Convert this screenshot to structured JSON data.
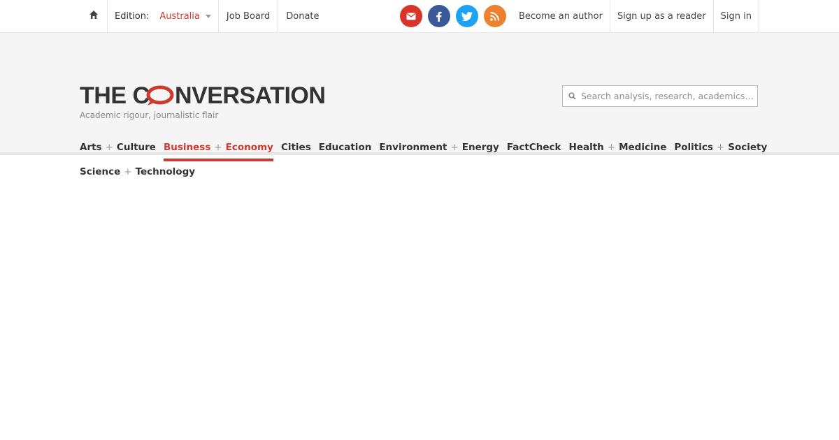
{
  "topbar": {
    "edition_label": "Edition:",
    "edition_value": "Australia",
    "links": [
      "Job Board",
      "Donate"
    ],
    "right_links": [
      "Become an author",
      "Sign up as a reader",
      "Sign in"
    ],
    "social": [
      "email-icon",
      "facebook-icon",
      "twitter-icon",
      "rss-icon"
    ]
  },
  "brand": {
    "name": "THE CONVERSATION",
    "tagline": "Academic rigour, journalistic flair",
    "accent": "#cf3a2f"
  },
  "search": {
    "placeholder": "Search analysis, research, academics…"
  },
  "nav": {
    "items": [
      {
        "a": "Arts",
        "b": "Culture"
      },
      {
        "a": "Business",
        "b": "Economy",
        "active": true
      },
      {
        "a": "Cities"
      },
      {
        "a": "Education"
      },
      {
        "a": "Environment",
        "b": "Energy"
      },
      {
        "a": "FactCheck"
      },
      {
        "a": "Health",
        "b": "Medicine"
      },
      {
        "a": "Politics",
        "b": "Society"
      },
      {
        "a": "Science",
        "b": "Technology"
      }
    ],
    "separator": "+"
  }
}
